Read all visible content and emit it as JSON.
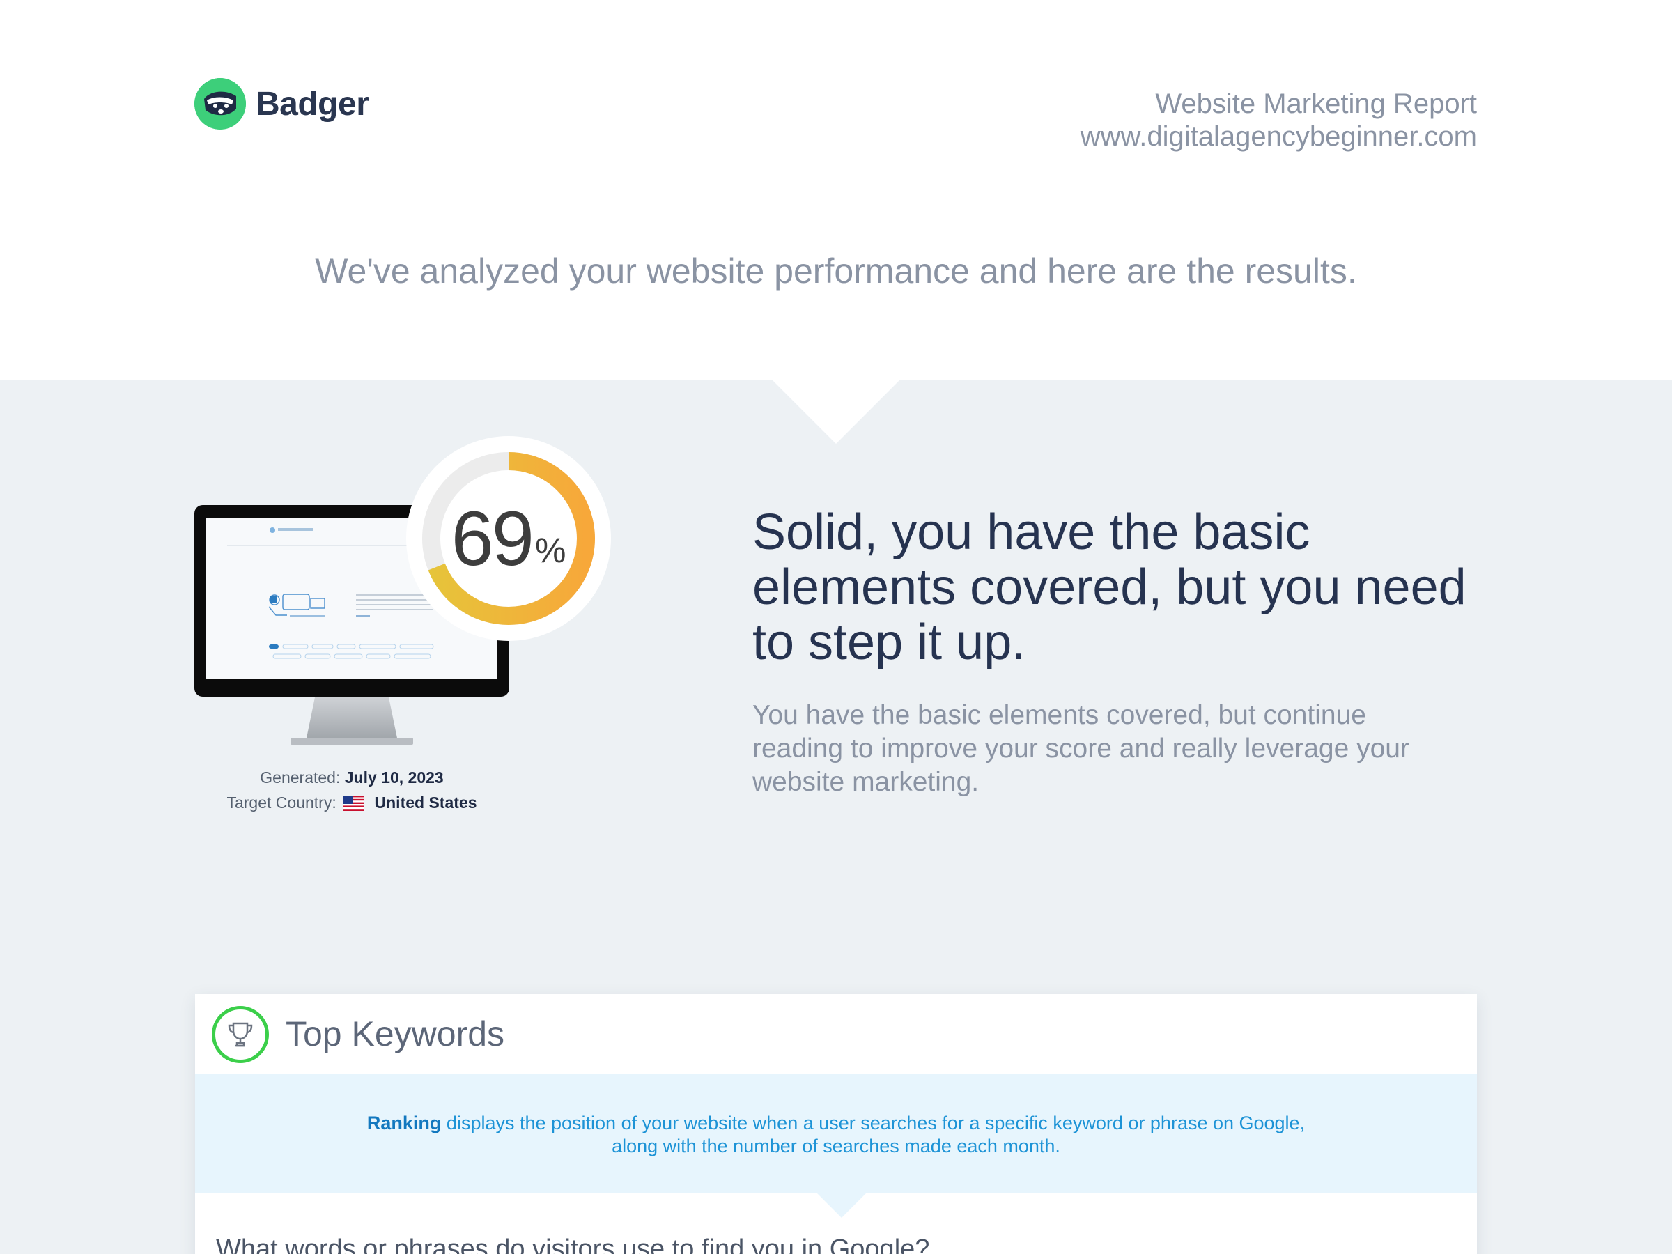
{
  "header": {
    "brand": "Badger",
    "report_title": "Website Marketing Report",
    "report_url": "www.digitalagencybeginner.com",
    "intro": "We've analyzed your website performance and here are the results."
  },
  "score": {
    "value": "69",
    "unit": "%",
    "fraction": 0.69
  },
  "meta": {
    "generated_label": "Generated:",
    "generated_value": "July 10, 2023",
    "country_label": "Target Country:",
    "country_value": "United States"
  },
  "summary": {
    "headline": "Solid, you have the basic elements covered, but you need to step it up.",
    "subtext": "You have the basic elements covered, but continue reading to improve your score and really leverage your website marketing."
  },
  "keywords_card": {
    "title": "Top Keywords",
    "info_bold": "Ranking",
    "info_line1_rest": " displays the position of your website when a user searches for a specific keyword or phrase on Google,",
    "info_line2": "along with the number of searches made each month.",
    "question": "What words or phrases do visitors use to find you in Google?"
  },
  "icons": {
    "logo": "badger-logo-icon",
    "trophy": "trophy-icon",
    "flag": "us-flag-icon"
  },
  "colors": {
    "brand_green": "#3dcf7a",
    "ring_start": "#e6c43a",
    "ring_end": "#f7a83a",
    "info_blue": "#1d93d6",
    "trophy_green": "#3bcf4a"
  }
}
